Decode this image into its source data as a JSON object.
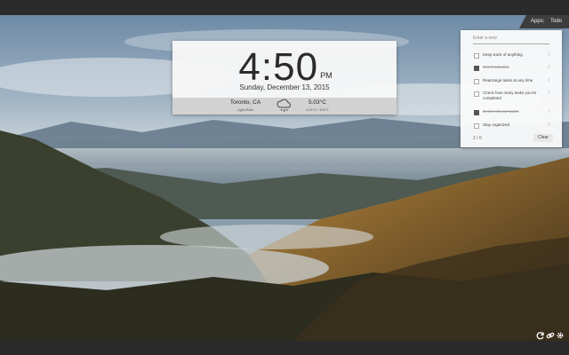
{
  "clock": {
    "time": "4:50",
    "ampm": "PM",
    "date": "Sunday, December 13, 2015"
  },
  "weather": {
    "location": "Toronto, CA",
    "condition": "Light Rain",
    "temp": "5.03°C",
    "range": "4.11°C / 5.5°C",
    "icon": "rain-cloud-icon"
  },
  "nav": {
    "apps": "Apps",
    "separator": "|",
    "todo": "Todo"
  },
  "todo": {
    "placeholder": "Enter a new",
    "items": [
      {
        "text": "Keep track of anything",
        "done": false
      },
      {
        "text": "Get Productive",
        "done": true
      },
      {
        "text": "Rearrange tasks at any time",
        "done": false
      },
      {
        "text": "Check how many tasks you've completed",
        "done": false
      },
      {
        "text": "Delete all your tasks",
        "done": true
      },
      {
        "text": "Stay organized",
        "done": false
      }
    ],
    "count": "2 / 6",
    "clear_label": "Clear"
  },
  "icons": {
    "refresh": "refresh-icon",
    "link": "link-icon",
    "settings": "gear-icon"
  }
}
